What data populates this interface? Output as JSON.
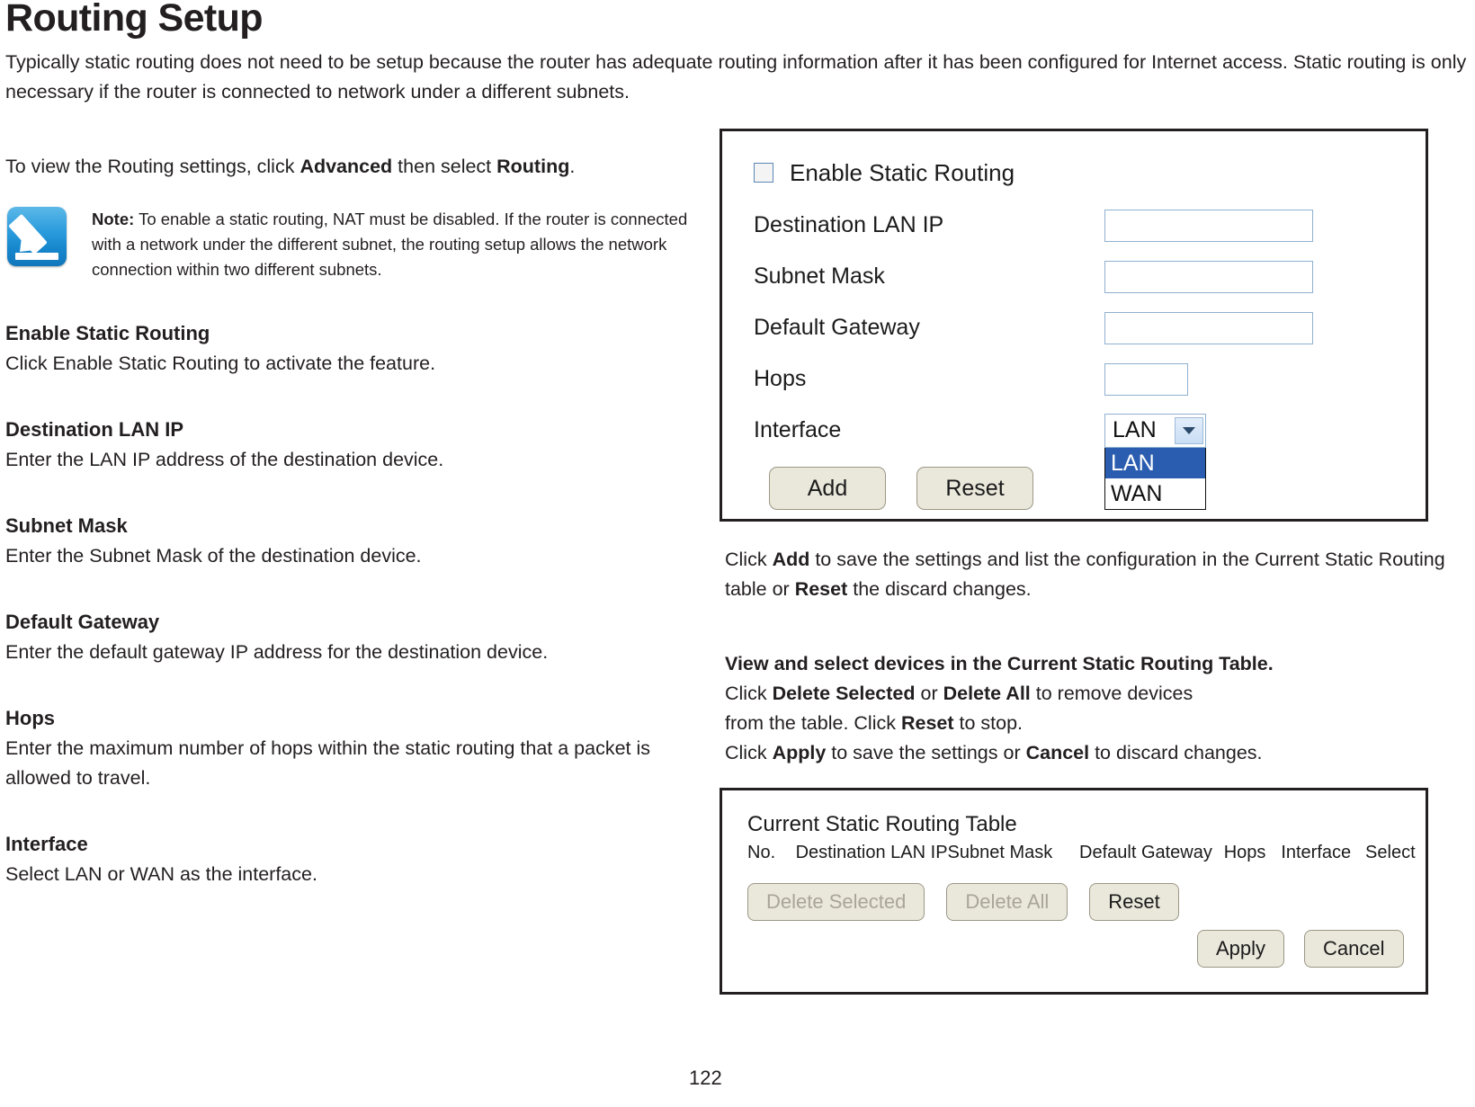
{
  "doc": {
    "title": "Routing Setup",
    "intro": "Typically static routing does not need to be setup because the router has adequate routing information after it has been configured for Internet access. Static routing is only necessary if the router is connected to network under a different subnets.",
    "page_number": "122"
  },
  "left": {
    "lead": {
      "pre": "To view the Routing settings, click ",
      "bold1": "Advanced",
      "mid": " then select ",
      "bold2": "Routing",
      "post": "."
    },
    "note": {
      "icon": "note-pencil-icon",
      "label": "Note:",
      "text": " To enable a static routing, NAT must be disabled. If the router is connected with a network under the different subnet, the routing setup allows the network connection within two different subnets."
    },
    "sections": [
      {
        "heading": "Enable Static Routing",
        "body": "Click Enable Static Routing to activate the feature."
      },
      {
        "heading": "Destination LAN IP",
        "body": "Enter the LAN IP address of the destination device."
      },
      {
        "heading": "Subnet Mask",
        "body": "Enter the Subnet Mask of the destination device."
      },
      {
        "heading": "Default Gateway",
        "body": "Enter the default gateway IP address for the destination device."
      },
      {
        "heading": "Hops",
        "body": "Enter the maximum number of hops within the static routing that a packet is allowed to travel."
      },
      {
        "heading": "Interface",
        "body": "Select LAN or WAN as the interface."
      }
    ]
  },
  "router_ui": {
    "enable_checkbox_label": "Enable Static Routing",
    "enable_checkbox_checked": false,
    "fields": [
      {
        "label": "Destination LAN IP",
        "value": "",
        "size": "long"
      },
      {
        "label": "Subnet Mask",
        "value": "",
        "size": "long"
      },
      {
        "label": "Default Gateway",
        "value": "",
        "size": "long"
      },
      {
        "label": "Hops",
        "value": "",
        "size": "short"
      }
    ],
    "interface": {
      "label": "Interface",
      "selected": "LAN",
      "options": [
        "LAN",
        "WAN"
      ],
      "open": true
    },
    "buttons": {
      "add": "Add",
      "reset": "Reset"
    }
  },
  "right_text": {
    "block1": {
      "pre": "Click ",
      "b1": "Add",
      "mid1": " to save the settings and list the configuration in the Current Static Routing table or ",
      "b2": "Reset",
      "post": " the discard changes."
    },
    "block2": {
      "heading": "View and select devices in the Current Static Routing Table.",
      "l1_pre": "Click ",
      "l1_b1": "Delete Selected",
      "l1_mid": " or ",
      "l1_b2": "Delete All",
      "l1_post": " to remove devices",
      "l2_pre": "from the table. Click ",
      "l2_b1": "Reset",
      "l2_post": " to stop.",
      "l3_pre": "Click ",
      "l3_b1": "Apply",
      "l3_mid": " to save the settings or ",
      "l3_b2": "Cancel",
      "l3_post": " to discard changes."
    }
  },
  "routing_table": {
    "title": "Current Static Routing Table",
    "columns": [
      "No.",
      "Destination LAN IP",
      "Subnet Mask",
      "Default Gateway",
      "Hops",
      "Interface",
      "Select"
    ],
    "rows": [],
    "buttons": {
      "delete_selected": "Delete Selected",
      "delete_selected_disabled": true,
      "delete_all": "Delete All",
      "delete_all_disabled": true,
      "reset": "Reset",
      "apply": "Apply",
      "cancel": "Cancel"
    }
  },
  "colors": {
    "text": "#231f20",
    "panel_border": "#231f20",
    "button_face": "#eae7db",
    "input_border": "#8fb0cf",
    "select_highlight": "#2a5db0",
    "note_icon": "#1787cd"
  }
}
